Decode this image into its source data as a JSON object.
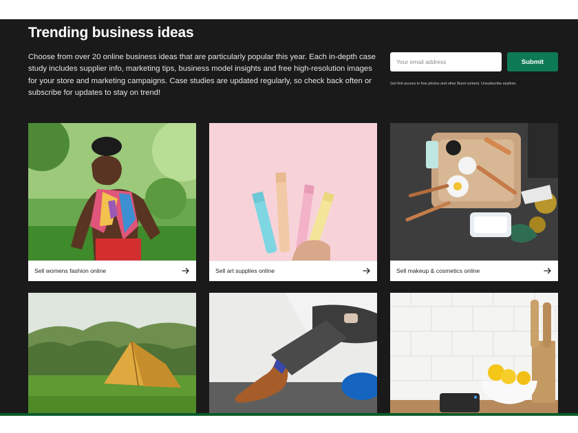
{
  "header": {
    "title": "Trending business ideas",
    "intro": "Choose from over 20 online business ideas that are particularly popular this year. Each in-depth case study includes supplier info, marketing tips, business model insights and free high-resolution images for your store and marketing campaigns. Case studies are updated regularly, so check back often or subscribe for updates to stay on trend!"
  },
  "signup": {
    "email_placeholder": "Your email address",
    "submit_label": "Submit",
    "disclaimer": "Get first access to free photos and other Burst content. Unsubscribe anytime."
  },
  "cards": [
    {
      "label": "Sell womens fashion online",
      "icon": "arrow-right-icon"
    },
    {
      "label": "Sell art supplies online",
      "icon": "arrow-right-icon"
    },
    {
      "label": "Sell makeup & cosmetics online",
      "icon": "arrow-right-icon"
    },
    {
      "label": ""
    },
    {
      "label": ""
    },
    {
      "label": ""
    }
  ],
  "colors": {
    "background": "#1a1a1a",
    "accent": "#0e7a55",
    "bottom_bar": "#0b5b2a"
  }
}
